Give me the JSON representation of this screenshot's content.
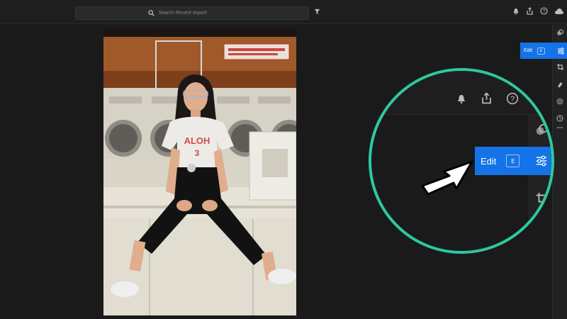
{
  "search": {
    "placeholder": "Search Recent Import"
  },
  "edit_panel": {
    "label": "Edit",
    "shortcut": "E"
  },
  "zoom_callout": {
    "edit_label": "Edit",
    "shortcut": "E",
    "ring_color": "#2ec8a0"
  },
  "colors": {
    "accent": "#1473e6",
    "background": "#1a1a1a",
    "toolbar": "#1e1e1e"
  },
  "icons": {
    "top_right": [
      "bell-icon",
      "share-icon",
      "help-icon",
      "cloud-icon"
    ],
    "toolbar": [
      "color-grading-icon",
      "edit-sliders-icon",
      "crop-icon",
      "healing-icon",
      "masking-icon",
      "history-icon",
      "more-icon"
    ]
  },
  "photo": {
    "alt": "Woman in a laundromat"
  }
}
